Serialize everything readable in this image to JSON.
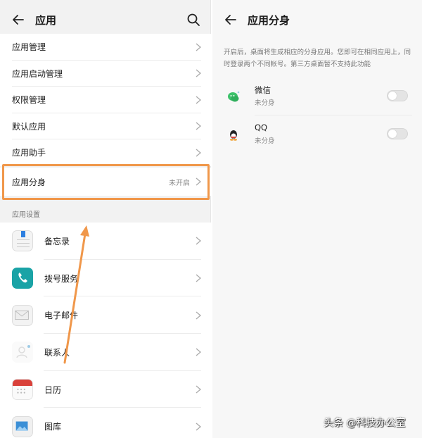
{
  "left_panel": {
    "title": "应用",
    "menu": [
      {
        "label": "应用管理",
        "value": ""
      },
      {
        "label": "应用启动管理",
        "value": ""
      },
      {
        "label": "权限管理",
        "value": ""
      },
      {
        "label": "默认应用",
        "value": ""
      },
      {
        "label": "应用助手",
        "value": ""
      },
      {
        "label": "应用分身",
        "value": "未开启"
      }
    ],
    "section_label": "应用设置",
    "apps": [
      {
        "label": "备忘录",
        "icon": "notepad-icon"
      },
      {
        "label": "拨号服务",
        "icon": "phone-icon"
      },
      {
        "label": "电子邮件",
        "icon": "mail-icon"
      },
      {
        "label": "联系人",
        "icon": "contacts-icon"
      },
      {
        "label": "日历",
        "icon": "calendar-icon"
      },
      {
        "label": "图库",
        "icon": "gallery-icon"
      }
    ]
  },
  "right_panel": {
    "title": "应用分身",
    "description": "开启后，桌面将生成相应的分身应用。您即可在相同应用上，同时登录两个不同帐号。第三方桌面暂不支持此功能",
    "apps": [
      {
        "name": "微信",
        "status": "未分身",
        "icon": "wechat-icon",
        "enabled": false
      },
      {
        "name": "QQ",
        "status": "未分身",
        "icon": "qq-icon",
        "enabled": false
      }
    ]
  },
  "watermark": "头条 @科技办公室",
  "colors": {
    "highlight": "#f0974a",
    "phone_icon": "#1aa3a6",
    "wechat": "#3dc26b"
  }
}
